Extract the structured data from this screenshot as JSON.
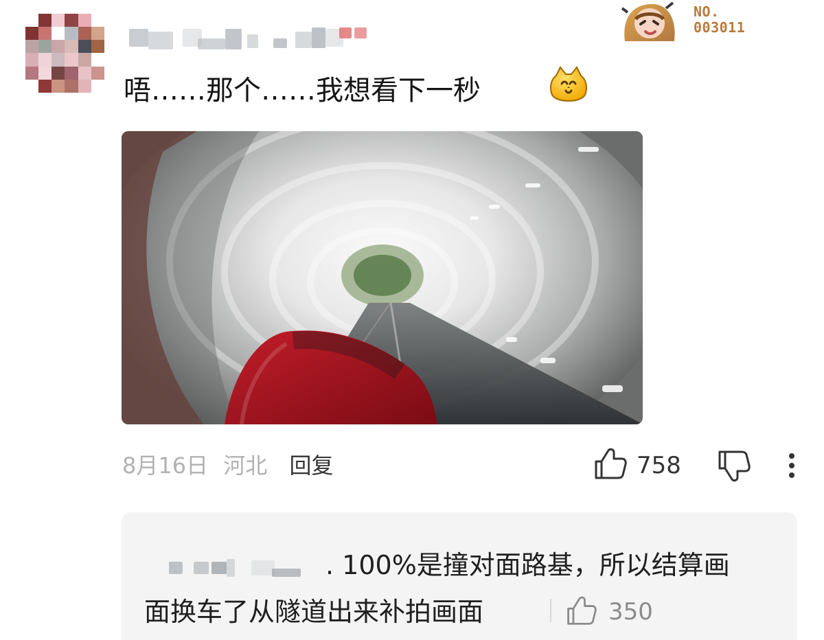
{
  "post": {
    "comment_text": "唔……那个……我想看下一秒",
    "emoji": "cat-smile-emoji"
  },
  "badge": {
    "number": "NO.\n003011"
  },
  "meta": {
    "date": "8月16日",
    "location": "河北",
    "reply_label": "回复",
    "like_count": "758"
  },
  "reply": {
    "line1": ". 100%是撞对面路基，所以结算画",
    "line2": "面换车了从隧道出来补拍画面",
    "like_count": "350"
  },
  "colors": {
    "badge": "#b87a3a",
    "meta_gray": "#b2b2b2",
    "reply_bg": "#f4f4f4"
  }
}
